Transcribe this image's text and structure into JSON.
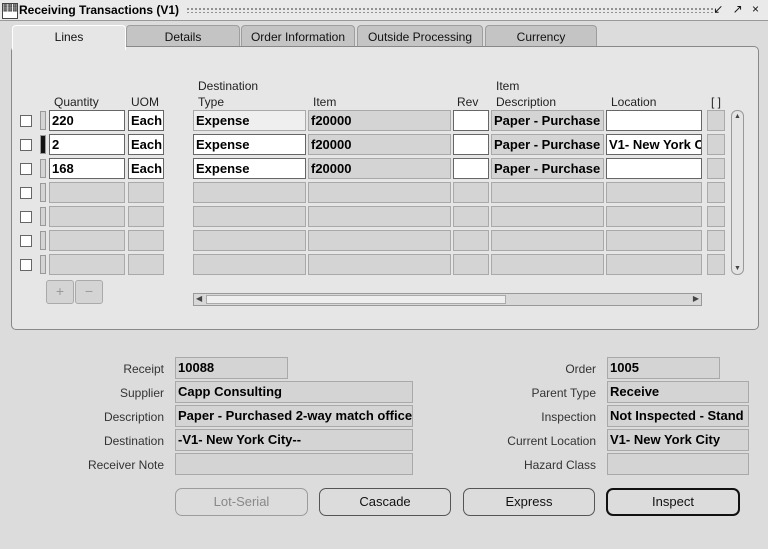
{
  "window": {
    "title": "Receiving Transactions (V1)",
    "controls": "↙ ↗ ×"
  },
  "tabs": [
    "Lines",
    "Details",
    "Order Information",
    "Outside Processing",
    "Currency"
  ],
  "grid": {
    "headers": {
      "quantity": "Quantity",
      "uom": "UOM",
      "dest_type_1": "Destination",
      "dest_type_2": "Type",
      "item": "Item",
      "rev": "Rev",
      "desc_1": "Item",
      "desc_2": "Description",
      "location": "Location",
      "flex": "[ ]"
    },
    "rows": [
      {
        "quantity": "220",
        "uom": "Each",
        "dest_type": "Expense",
        "item": "f20000",
        "rev": "",
        "description": "Paper - Purchase",
        "location": ""
      },
      {
        "quantity": "2",
        "uom": "Each",
        "dest_type": "Expense",
        "item": "f20000",
        "rev": "",
        "description": "Paper - Purchase",
        "location": "V1- New York C"
      },
      {
        "quantity": "168",
        "uom": "Each",
        "dest_type": "Expense",
        "item": "f20000",
        "rev": "",
        "description": "Paper - Purchase",
        "location": ""
      }
    ]
  },
  "row_buttons": {
    "add": "+",
    "remove": "−"
  },
  "fields": {
    "receipt": {
      "label": "Receipt",
      "value": "10088"
    },
    "supplier": {
      "label": "Supplier",
      "value": "Capp Consulting"
    },
    "description": {
      "label": "Description",
      "value": "Paper - Purchased 2-way match office"
    },
    "destination": {
      "label": "Destination",
      "value": "-V1- New York City--"
    },
    "receiver_note": {
      "label": "Receiver Note",
      "value": ""
    },
    "order": {
      "label": "Order",
      "value": "1005"
    },
    "parent_type": {
      "label": "Parent Type",
      "value": "Receive"
    },
    "inspection": {
      "label": "Inspection",
      "value": "Not Inspected - Stand"
    },
    "current_location": {
      "label": "Current Location",
      "value": "V1- New York City"
    },
    "hazard_class": {
      "label": "Hazard Class",
      "value": ""
    }
  },
  "buttons": {
    "lot_serial": "Lot-Serial",
    "cascade": "Cascade",
    "express": "Express",
    "inspect": "Inspect"
  }
}
